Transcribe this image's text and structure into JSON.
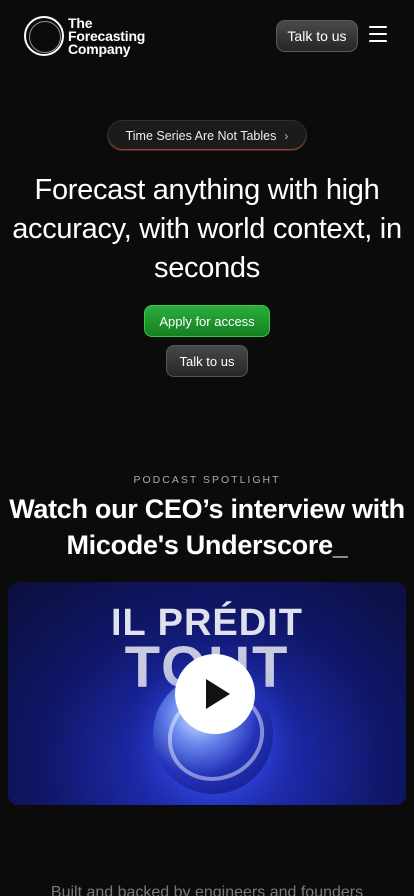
{
  "header": {
    "logo_lines": [
      "The",
      "Forecasting",
      "Company"
    ],
    "talk_label": "Talk to us",
    "menu_icon": "hamburger-menu-icon"
  },
  "hero": {
    "pill_label": "Time Series Are Not Tables",
    "pill_icon": "chevron-right-icon",
    "title": "Forecast anything with high accuracy, with world context, in seconds",
    "apply_label": "Apply for access",
    "talk_label": "Talk to us"
  },
  "podcast": {
    "eyebrow": "PODCAST SPOTLIGHT",
    "title": "Watch our CEO’s interview with Micode's Underscore_",
    "video_title_line1": "IL PRÉDIT",
    "video_title_line2": "TOUT",
    "play_icon": "play-icon"
  },
  "footer": {
    "note": "Built and backed by engineers and founders"
  },
  "colors": {
    "background": "#0b0b0c",
    "accent_green": "#1f9a30",
    "video_blue": "#1b27a0"
  }
}
